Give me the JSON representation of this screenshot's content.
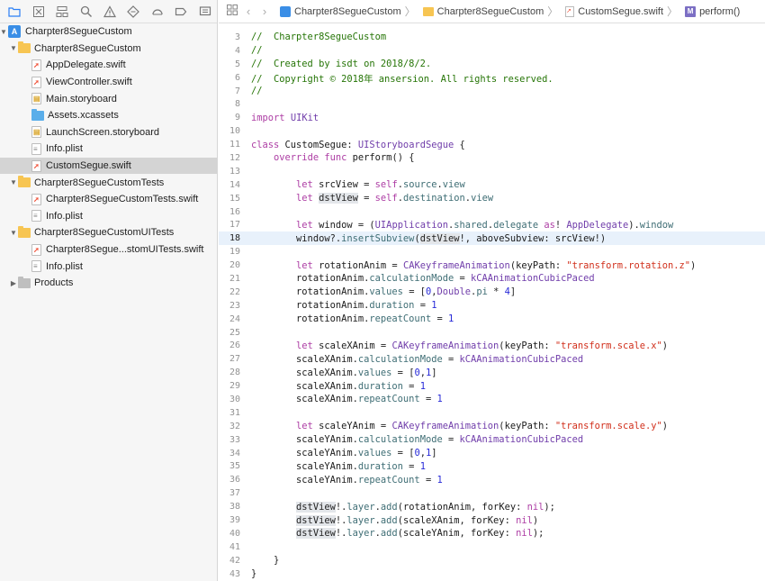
{
  "navigator": {
    "tree": [
      {
        "label": "Charpter8SegueCustom",
        "indent": 0,
        "kind": "project",
        "disclosure": "open"
      },
      {
        "label": "Charpter8SegueCustom",
        "indent": 1,
        "kind": "folder",
        "disclosure": "open"
      },
      {
        "label": "AppDelegate.swift",
        "indent": 2,
        "kind": "swift"
      },
      {
        "label": "ViewController.swift",
        "indent": 2,
        "kind": "swift"
      },
      {
        "label": "Main.storyboard",
        "indent": 2,
        "kind": "storyboard"
      },
      {
        "label": "Assets.xcassets",
        "indent": 2,
        "kind": "assets"
      },
      {
        "label": "LaunchScreen.storyboard",
        "indent": 2,
        "kind": "storyboard"
      },
      {
        "label": "Info.plist",
        "indent": 2,
        "kind": "plist"
      },
      {
        "label": "CustomSegue.swift",
        "indent": 2,
        "kind": "swift",
        "selected": true
      },
      {
        "label": "Charpter8SegueCustomTests",
        "indent": 1,
        "kind": "folder",
        "disclosure": "open"
      },
      {
        "label": "Charpter8SegueCustomTests.swift",
        "indent": 2,
        "kind": "swift"
      },
      {
        "label": "Info.plist",
        "indent": 2,
        "kind": "plist"
      },
      {
        "label": "Charpter8SegueCustomUITests",
        "indent": 1,
        "kind": "folder",
        "disclosure": "open"
      },
      {
        "label": "Charpter8Segue...stomUITests.swift",
        "indent": 2,
        "kind": "swift"
      },
      {
        "label": "Info.plist",
        "indent": 2,
        "kind": "plist"
      },
      {
        "label": "Products",
        "indent": 1,
        "kind": "folder-gray",
        "disclosure": "closed"
      }
    ]
  },
  "jumpbar": {
    "crumbs": [
      {
        "label": "Charpter8SegueCustom",
        "icon": "project"
      },
      {
        "label": "Charpter8SegueCustom",
        "icon": "folder"
      },
      {
        "label": "CustomSegue.swift",
        "icon": "swift"
      },
      {
        "label": "perform()",
        "icon": "method"
      }
    ]
  },
  "editor": {
    "current_line": "18",
    "lines": [
      {
        "n": "3",
        "t": "//  Charpter8SegueCustom"
      },
      {
        "n": "4",
        "t": "//"
      },
      {
        "n": "5",
        "t": "//  Created by isdt on 2018/8/2."
      },
      {
        "n": "6",
        "t": "//  Copyright © 2018年 ansersion. All rights reserved."
      },
      {
        "n": "7",
        "t": "//"
      },
      {
        "n": "8",
        "t": ""
      },
      {
        "n": "9",
        "t": "import UIKit"
      },
      {
        "n": "10",
        "t": ""
      },
      {
        "n": "11",
        "t": "class CustomSegue: UIStoryboardSegue {"
      },
      {
        "n": "12",
        "t": "    override func perform() {"
      },
      {
        "n": "13",
        "t": ""
      },
      {
        "n": "14",
        "t": "        let srcView = self.source.view"
      },
      {
        "n": "15",
        "t": "        let dstView = self.destination.view"
      },
      {
        "n": "16",
        "t": ""
      },
      {
        "n": "17",
        "t": "        let window = (UIApplication.shared.delegate as! AppDelegate).window"
      },
      {
        "n": "18",
        "t": "        window?.insertSubview(dstView!, aboveSubview: srcView!)"
      },
      {
        "n": "19",
        "t": ""
      },
      {
        "n": "20",
        "t": "        let rotationAnim = CAKeyframeAnimation(keyPath: \"transform.rotation.z\")"
      },
      {
        "n": "21",
        "t": "        rotationAnim.calculationMode = kCAAnimationCubicPaced"
      },
      {
        "n": "22",
        "t": "        rotationAnim.values = [0,Double.pi * 4]"
      },
      {
        "n": "23",
        "t": "        rotationAnim.duration = 1"
      },
      {
        "n": "24",
        "t": "        rotationAnim.repeatCount = 1"
      },
      {
        "n": "25",
        "t": ""
      },
      {
        "n": "26",
        "t": "        let scaleXAnim = CAKeyframeAnimation(keyPath: \"transform.scale.x\")"
      },
      {
        "n": "27",
        "t": "        scaleXAnim.calculationMode = kCAAnimationCubicPaced"
      },
      {
        "n": "28",
        "t": "        scaleXAnim.values = [0,1]"
      },
      {
        "n": "29",
        "t": "        scaleXAnim.duration = 1"
      },
      {
        "n": "30",
        "t": "        scaleXAnim.repeatCount = 1"
      },
      {
        "n": "31",
        "t": ""
      },
      {
        "n": "32",
        "t": "        let scaleYAnim = CAKeyframeAnimation(keyPath: \"transform.scale.y\")"
      },
      {
        "n": "33",
        "t": "        scaleYAnim.calculationMode = kCAAnimationCubicPaced"
      },
      {
        "n": "34",
        "t": "        scaleYAnim.values = [0,1]"
      },
      {
        "n": "35",
        "t": "        scaleYAnim.duration = 1"
      },
      {
        "n": "36",
        "t": "        scaleYAnim.repeatCount = 1"
      },
      {
        "n": "37",
        "t": ""
      },
      {
        "n": "38",
        "t": "        dstView!.layer.add(rotationAnim, forKey: nil);"
      },
      {
        "n": "39",
        "t": "        dstView!.layer.add(scaleXAnim, forKey: nil)"
      },
      {
        "n": "40",
        "t": "        dstView!.layer.add(scaleYAnim, forKey: nil);"
      },
      {
        "n": "41",
        "t": ""
      },
      {
        "n": "42",
        "t": "    }"
      },
      {
        "n": "43",
        "t": "}"
      }
    ]
  }
}
